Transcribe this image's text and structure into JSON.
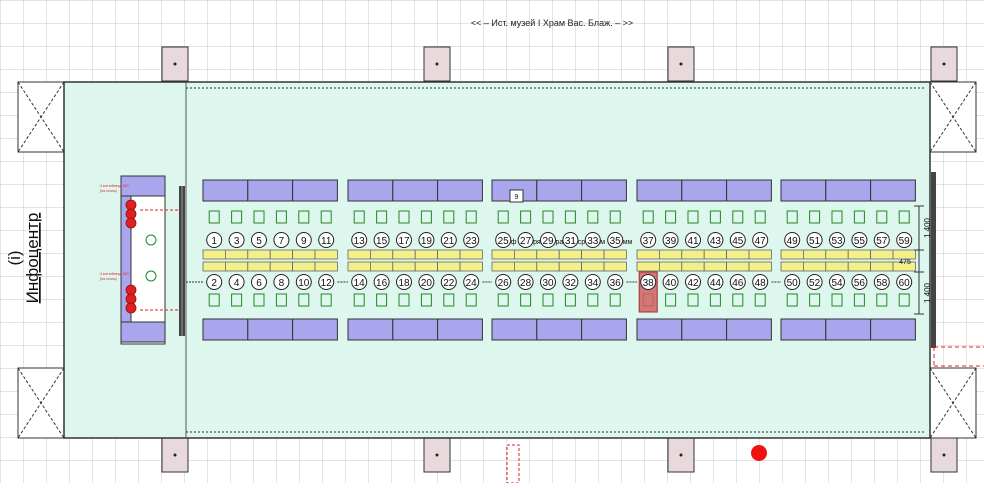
{
  "header": {
    "nav_label": "<< – Ист. музей I Храм Вас. Блаж. – >>"
  },
  "infocenter": {
    "icon_label": "(i)",
    "label": "Инфоцентр"
  },
  "booths": {
    "top_row": [
      [
        "1",
        "3",
        "5",
        "7",
        "9",
        "11"
      ],
      [
        "13",
        "15",
        "17",
        "19",
        "21",
        "23"
      ],
      [
        "25",
        "27",
        "29",
        "31",
        "33",
        "35"
      ],
      [
        "37",
        "39",
        "41",
        "43",
        "45",
        "47"
      ],
      [
        "49",
        "51",
        "53",
        "55",
        "57",
        "59"
      ]
    ],
    "bottom_row": [
      [
        "2",
        "4",
        "6",
        "8",
        "10",
        "12"
      ],
      [
        "14",
        "16",
        "18",
        "20",
        "22",
        "24"
      ],
      [
        "26",
        "28",
        "30",
        "32",
        "34",
        "36"
      ],
      [
        "38",
        "40",
        "42",
        "44",
        "46",
        "48"
      ],
      [
        "50",
        "52",
        "54",
        "56",
        "58",
        "60"
      ]
    ],
    "top_suffixes": {
      "25": "ф",
      "27": "ря",
      "29": "ра",
      "31": "ср",
      "33": "м",
      "35": "мм"
    },
    "highlighted": "38",
    "center_marker": "9"
  },
  "dimensions": {
    "upper": "1 400",
    "middle": "475",
    "lower": "1 400"
  },
  "entrance": {
    "labels": [
      "3 контейнера 240",
      "(на столы)",
      "3 контейнера 240",
      "(на столы)"
    ]
  },
  "colors": {
    "floor": "#ddf6ee",
    "grid": "#c9c9c9",
    "counter": "#a9a6ee",
    "table": "#f3f08a",
    "stool": "#1f8a1f",
    "accent": "#e02020",
    "highlight": "#d06060"
  }
}
